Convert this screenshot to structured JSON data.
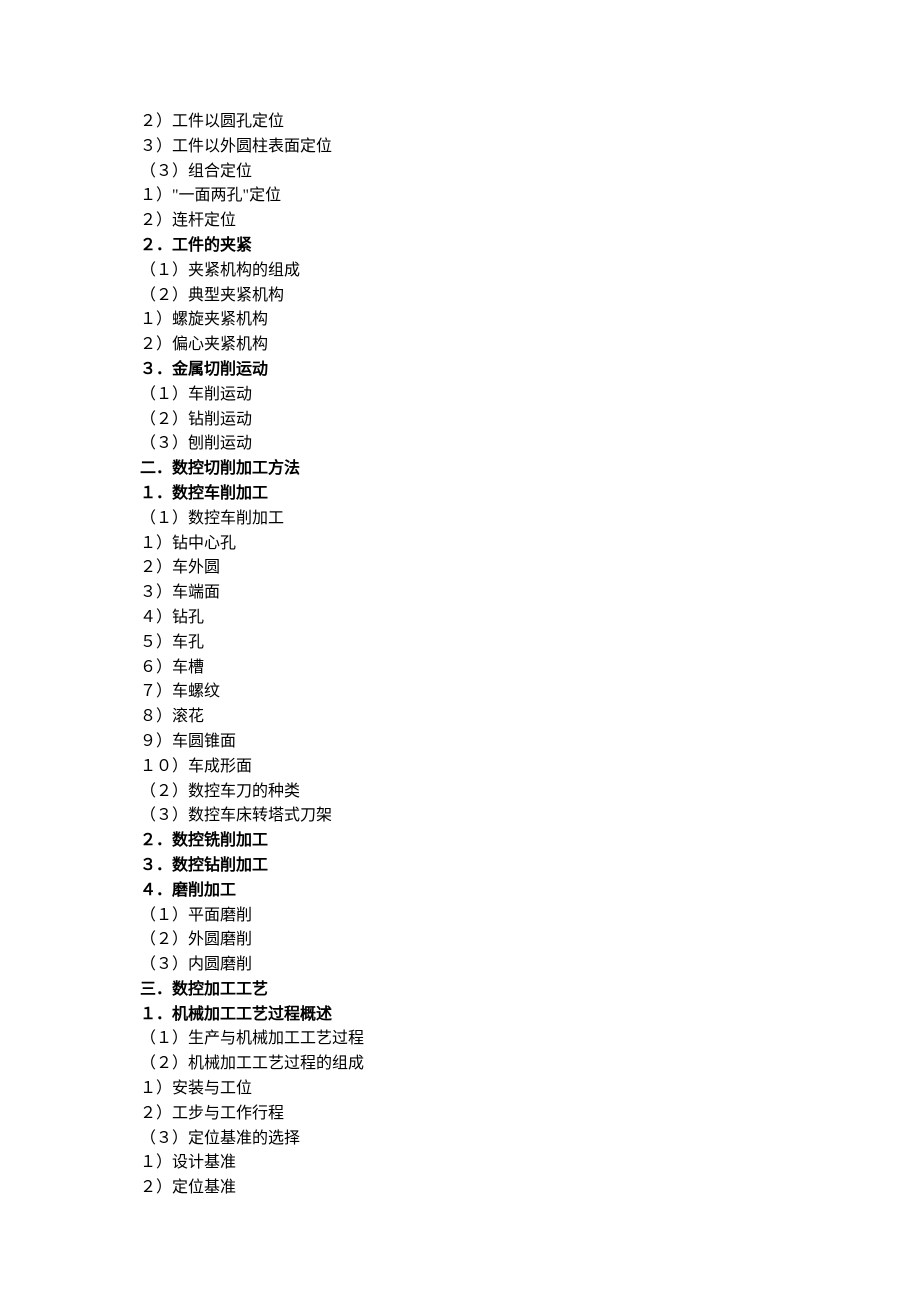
{
  "lines": [
    {
      "text": "２）工件以圆孔定位",
      "bold": false
    },
    {
      "text": "３）工件以外圆柱表面定位",
      "bold": false
    },
    {
      "text": "（３）组合定位",
      "bold": false
    },
    {
      "text": "１）\"一面两孔\"定位",
      "bold": false
    },
    {
      "text": "２）连杆定位",
      "bold": false
    },
    {
      "text": "２．工件的夹紧",
      "bold": true
    },
    {
      "text": "（１）夹紧机构的组成",
      "bold": false
    },
    {
      "text": "（２）典型夹紧机构",
      "bold": false
    },
    {
      "text": "１）螺旋夹紧机构",
      "bold": false
    },
    {
      "text": "２）偏心夹紧机构",
      "bold": false
    },
    {
      "text": "３．金属切削运动",
      "bold": true
    },
    {
      "text": "（１）车削运动",
      "bold": false
    },
    {
      "text": "（２）钻削运动",
      "bold": false
    },
    {
      "text": "（３）刨削运动",
      "bold": false
    },
    {
      "text": "二．数控切削加工方法",
      "bold": true
    },
    {
      "text": "１．数控车削加工",
      "bold": true
    },
    {
      "text": "（１）数控车削加工",
      "bold": false
    },
    {
      "text": "１）钻中心孔",
      "bold": false
    },
    {
      "text": "２）车外圆",
      "bold": false
    },
    {
      "text": "３）车端面",
      "bold": false
    },
    {
      "text": "４）钻孔",
      "bold": false
    },
    {
      "text": "５）车孔",
      "bold": false
    },
    {
      "text": "６）车槽",
      "bold": false
    },
    {
      "text": "７）车螺纹",
      "bold": false
    },
    {
      "text": "８）滚花",
      "bold": false
    },
    {
      "text": "９）车圆锥面",
      "bold": false
    },
    {
      "text": "１０）车成形面",
      "bold": false
    },
    {
      "text": "（２）数控车刀的种类",
      "bold": false
    },
    {
      "text": "（３）数控车床转塔式刀架",
      "bold": false
    },
    {
      "text": "２．数控铣削加工",
      "bold": true
    },
    {
      "text": "３．数控钻削加工",
      "bold": true
    },
    {
      "text": "４．磨削加工",
      "bold": true
    },
    {
      "text": "（１）平面磨削",
      "bold": false
    },
    {
      "text": "（２）外圆磨削",
      "bold": false
    },
    {
      "text": "（３）内圆磨削",
      "bold": false
    },
    {
      "text": "三．数控加工工艺",
      "bold": true
    },
    {
      "text": "１．机械加工工艺过程概述",
      "bold": true
    },
    {
      "text": "（１）生产与机械加工工艺过程",
      "bold": false
    },
    {
      "text": "（２）机械加工工艺过程的组成",
      "bold": false
    },
    {
      "text": "１）安装与工位",
      "bold": false
    },
    {
      "text": "２）工步与工作行程",
      "bold": false
    },
    {
      "text": "（３）定位基准的选择",
      "bold": false
    },
    {
      "text": "１）设计基准",
      "bold": false
    },
    {
      "text": "２）定位基准",
      "bold": false
    }
  ]
}
